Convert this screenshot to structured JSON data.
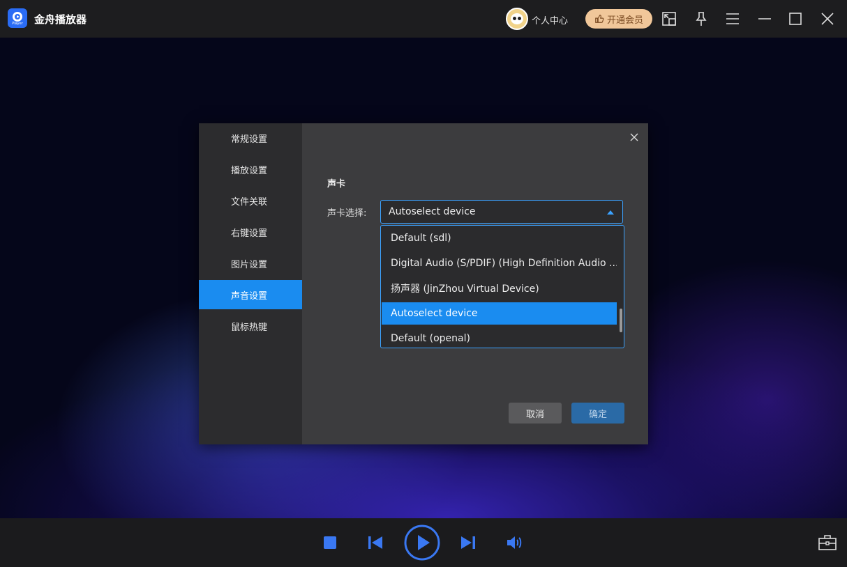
{
  "app": {
    "title": "金舟播放器",
    "logo_text": "Player"
  },
  "header": {
    "user_center": "个人中心",
    "vip_label": "开通会员",
    "icons": [
      "mini-mode-icon",
      "pin-icon",
      "menu-icon",
      "minimize-icon",
      "maximize-icon",
      "close-icon"
    ]
  },
  "settings": {
    "nav": [
      {
        "label": "常规设置",
        "active": false
      },
      {
        "label": "播放设置",
        "active": false
      },
      {
        "label": "文件关联",
        "active": false
      },
      {
        "label": "右键设置",
        "active": false
      },
      {
        "label": "图片设置",
        "active": false
      },
      {
        "label": "声音设置",
        "active": true
      },
      {
        "label": "鼠标热键",
        "active": false
      }
    ],
    "section_title": "声卡",
    "field_label": "声卡选择:",
    "selected_device": "Autoselect device",
    "options": [
      {
        "label": "Default (sdl)",
        "selected": false
      },
      {
        "label": "Digital Audio (S/PDIF) (High Definition Audio ...",
        "selected": false
      },
      {
        "label": "扬声器 (JinZhou Virtual Device)",
        "selected": false
      },
      {
        "label": "Autoselect device",
        "selected": true
      },
      {
        "label": "Default (openal)",
        "selected": false
      }
    ],
    "cancel_label": "取消",
    "ok_label": "确定"
  },
  "colors": {
    "accent": "#1a8cf0",
    "control_blue": "#3a78f2",
    "vip_bg": "#f1c79a"
  },
  "controls": [
    "stop-icon",
    "previous-icon",
    "play-icon",
    "next-icon",
    "volume-icon",
    "toolbox-icon"
  ]
}
